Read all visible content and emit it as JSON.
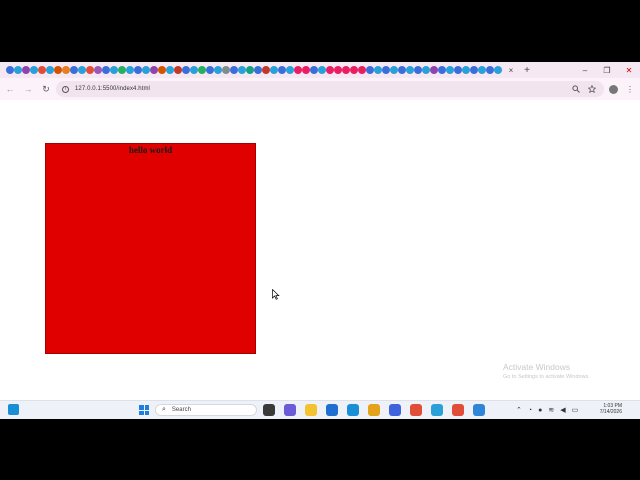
{
  "browser": {
    "url": "127.0.0.1:5500/index4.html",
    "tab_close": "×",
    "new_tab": "+",
    "tab_favicon_colors": [
      "#3b6fd8",
      "#2aa0d8",
      "#8e44ad",
      "#2aa0d8",
      "#e04e3a",
      "#2aa0d8",
      "#d35400",
      "#e67e22",
      "#3b6fd8",
      "#2aa0d8",
      "#e04e3a",
      "#9b59b6",
      "#3b6fd8",
      "#2aa0d8",
      "#27ae60",
      "#2aa0d8",
      "#3b6fd8",
      "#2aa0d8",
      "#8e44ad",
      "#d35400",
      "#2aa0d8",
      "#c0392b",
      "#3b6fd8",
      "#2aa0d8",
      "#27ae60",
      "#3b6fd8",
      "#2aa0d8",
      "#7f8c8d",
      "#3b6fd8",
      "#2aa0d8",
      "#16a085",
      "#3b6fd8",
      "#c0392b",
      "#2aa0d8",
      "#3b6fd8",
      "#2aa0d8",
      "#e91e63",
      "#e91e63",
      "#3b6fd8",
      "#2aa0d8",
      "#e91e63",
      "#e91e63",
      "#e91e63",
      "#e91e63",
      "#e91e63",
      "#3b6fd8",
      "#2aa0d8",
      "#3b6fd8",
      "#2aa0d8",
      "#3b6fd8",
      "#2aa0d8",
      "#3b6fd8",
      "#2aa0d8",
      "#8e44ad",
      "#3b6fd8",
      "#2aa0d8",
      "#3b6fd8",
      "#2aa0d8",
      "#3b6fd8",
      "#2aa0d8",
      "#3b6fd8",
      "#2aa0d8"
    ],
    "window_controls": {
      "minimize": "–",
      "restore": "❐",
      "close": "✕"
    },
    "nav": {
      "back": "←",
      "forward": "→",
      "reload": "↻"
    }
  },
  "page": {
    "box_label": "hello world",
    "box_color": "#e10000",
    "watermark_title": "Activate Windows",
    "watermark_sub": "Go to Settings to activate Windows."
  },
  "taskbar": {
    "search_label": "Search",
    "time": "1:03 PM",
    "date": "7/14/2026",
    "app_icon_colors": [
      "#3a3a3a",
      "#6b5bd6",
      "#f2c230",
      "#1f6fd1",
      "#1a8fd6",
      "#e3a21a",
      "#3e63dd",
      "#e04e3a",
      "#2aa0d8",
      "#e04e3a",
      "#2f86d8"
    ]
  }
}
